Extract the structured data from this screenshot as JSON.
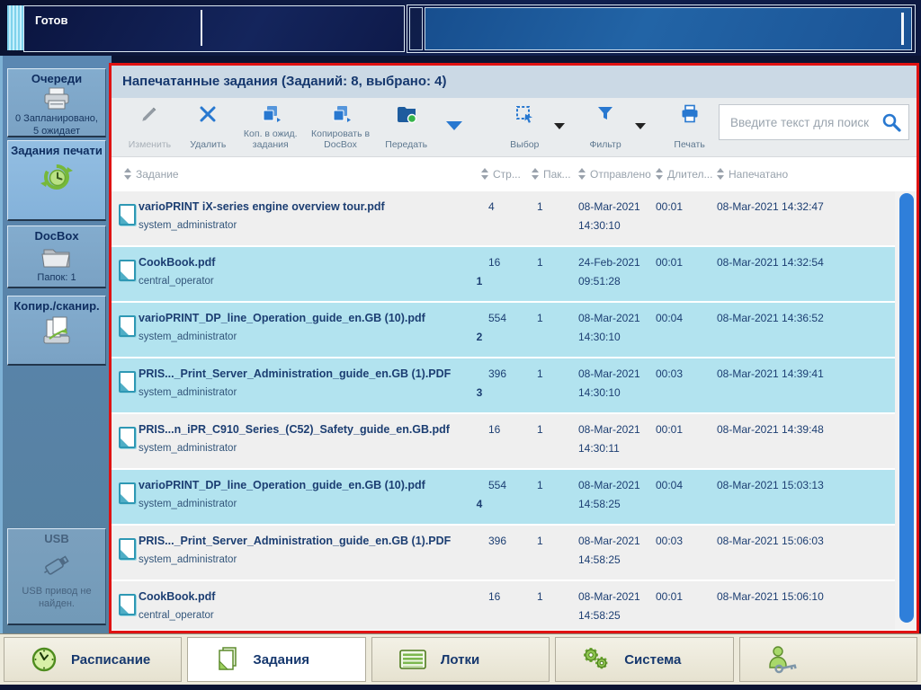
{
  "status_bar": {
    "status": "Готов"
  },
  "sidebar": {
    "items": [
      {
        "title": "Очереди",
        "sub1": "0 Запланировано,",
        "sub2": "5 ожидает",
        "icon": "printer-queue-icon",
        "selected": false
      },
      {
        "title": "Задания печати",
        "sub1": "",
        "sub2": "",
        "icon": "print-jobs-icon",
        "selected": true
      },
      {
        "title": "DocBox",
        "sub1": "Папок: 1",
        "sub2": "",
        "icon": "folder-icon",
        "selected": false
      },
      {
        "title": "Копир./сканир.",
        "sub1": "",
        "sub2": "",
        "icon": "copy-scan-icon",
        "selected": false
      },
      {
        "title": "USB",
        "sub1": "USB привод не",
        "sub2": "найден.",
        "icon": "usb-icon",
        "selected": false,
        "disabled": true
      }
    ]
  },
  "main": {
    "title": "Напечатанные задания (Заданий: 8, выбрано: 4)",
    "toolbar": {
      "buttons": [
        {
          "label": "Изменить",
          "icon": "pencil-icon",
          "disabled": true
        },
        {
          "label": "Удалить",
          "icon": "delete-x-icon",
          "disabled": false
        },
        {
          "label": "Коп. в ожид. задания",
          "icon": "copy-icon",
          "disabled": false
        },
        {
          "label": "Копировать в DocBox",
          "icon": "copy-icon",
          "disabled": false
        },
        {
          "label": "Передать",
          "icon": "transfer-folder-icon",
          "disabled": false
        },
        {
          "label": "Выбор",
          "icon": "select-icon",
          "disabled": false
        },
        {
          "label": "Фильтр",
          "icon": "filter-icon",
          "disabled": false
        },
        {
          "label": "Печать",
          "icon": "print-icon",
          "disabled": false
        }
      ],
      "search": {
        "placeholder": "Введите текст для поиск"
      }
    },
    "table": {
      "columns": [
        "Задание",
        "Стр...",
        "Пак...",
        "Отправлено",
        "Длител...",
        "Напечатано"
      ],
      "rows": [
        {
          "name": "varioPRINT iX-series engine overview tour.pdf",
          "owner": "system_administrator",
          "sel_num": "",
          "pages": "4",
          "sets": "1",
          "sent_date": "08-Mar-2021",
          "sent_time": "14:30:10",
          "duration": "00:01",
          "printed": "08-Mar-2021 14:32:47",
          "selected": false
        },
        {
          "name": "CookBook.pdf",
          "owner": "central_operator",
          "sel_num": "1",
          "pages": "16",
          "sets": "1",
          "sent_date": "24-Feb-2021",
          "sent_time": "09:51:28",
          "duration": "00:01",
          "printed": "08-Mar-2021 14:32:54",
          "selected": true
        },
        {
          "name": "varioPRINT_DP_line_Operation_guide_en.GB (10).pdf",
          "owner": "system_administrator",
          "sel_num": "2",
          "pages": "554",
          "sets": "1",
          "sent_date": "08-Mar-2021",
          "sent_time": "14:30:10",
          "duration": "00:04",
          "printed": "08-Mar-2021 14:36:52",
          "selected": true
        },
        {
          "name": "PRIS..._Print_Server_Administration_guide_en.GB (1).PDF",
          "owner": "system_administrator",
          "sel_num": "3",
          "pages": "396",
          "sets": "1",
          "sent_date": "08-Mar-2021",
          "sent_time": "14:30:10",
          "duration": "00:03",
          "printed": "08-Mar-2021 14:39:41",
          "selected": true
        },
        {
          "name": "PRIS...n_iPR_C910_Series_(C52)_Safety_guide_en.GB.pdf",
          "owner": "system_administrator",
          "sel_num": "",
          "pages": "16",
          "sets": "1",
          "sent_date": "08-Mar-2021",
          "sent_time": "14:30:11",
          "duration": "00:01",
          "printed": "08-Mar-2021 14:39:48",
          "selected": false
        },
        {
          "name": "varioPRINT_DP_line_Operation_guide_en.GB (10).pdf",
          "owner": "system_administrator",
          "sel_num": "4",
          "pages": "554",
          "sets": "1",
          "sent_date": "08-Mar-2021",
          "sent_time": "14:58:25",
          "duration": "00:04",
          "printed": "08-Mar-2021 15:03:13",
          "selected": true
        },
        {
          "name": "PRIS..._Print_Server_Administration_guide_en.GB (1).PDF",
          "owner": "system_administrator",
          "sel_num": "",
          "pages": "396",
          "sets": "1",
          "sent_date": "08-Mar-2021",
          "sent_time": "14:58:25",
          "duration": "00:03",
          "printed": "08-Mar-2021 15:06:03",
          "selected": false
        },
        {
          "name": "CookBook.pdf",
          "owner": "central_operator",
          "sel_num": "",
          "pages": "16",
          "sets": "1",
          "sent_date": "08-Mar-2021",
          "sent_time": "14:58:25",
          "duration": "00:01",
          "printed": "08-Mar-2021 15:06:10",
          "selected": false
        }
      ]
    }
  },
  "bottom_tabs": [
    {
      "label": "Расписание",
      "icon": "clock-icon",
      "active": false
    },
    {
      "label": "Задания",
      "icon": "jobs-document-icon",
      "active": true
    },
    {
      "label": "Лотки",
      "icon": "trays-icon",
      "active": false
    },
    {
      "label": "Система",
      "icon": "gears-icon",
      "active": false
    },
    {
      "label": "",
      "icon": "user-key-icon",
      "active": false
    }
  ],
  "colors": {
    "accent_blue": "#2878D0",
    "selection_cyan": "#B2E3EF",
    "alert_red_border": "#E01212",
    "sidebar_blue": "#5B87B2",
    "green_icon": "#7CB83E"
  }
}
